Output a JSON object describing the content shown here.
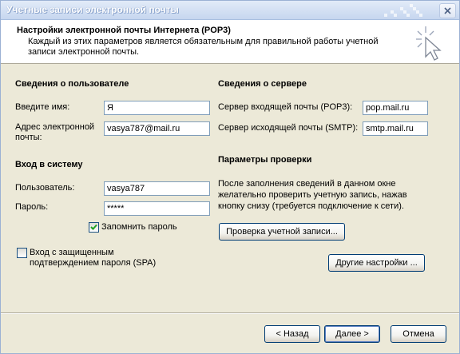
{
  "window": {
    "title": "Учетные записи электронной почты"
  },
  "header": {
    "title": "Настройки электронной почты Интернета (POP3)",
    "description": "Каждый из этих параметров является обязательным для правильной работы учетной записи электронной почты."
  },
  "user_info": {
    "heading": "Сведения о пользователе",
    "name_label": "Введите имя:",
    "name_value": "Я",
    "email_label_line1": "Адрес электронной",
    "email_label_line2": "почты:",
    "email_value": "vasya787@mail.ru"
  },
  "login": {
    "heading": "Вход в систему",
    "user_label": "Пользователь:",
    "user_value": "vasya787",
    "password_label": "Пароль:",
    "password_value": "*****",
    "remember_label": "Запомнить пароль",
    "remember_checked": true,
    "spa_label_line1": "Вход с защищенным",
    "spa_label_line2": "подтверждением пароля (SPA)",
    "spa_checked": false
  },
  "server_info": {
    "heading": "Сведения о сервере",
    "incoming_label": "Сервер входящей почты (POP3):",
    "incoming_value": "pop.mail.ru",
    "outgoing_label": "Сервер исходящей почты (SMTP):",
    "outgoing_value": "smtp.mail.ru"
  },
  "test": {
    "heading": "Параметры проверки",
    "description": "После заполнения сведений в данном окне желательно проверить учетную запись, нажав кнопку снизу (требуется подключение к сети).",
    "test_button": "Проверка учетной записи...",
    "more_button": "Другие настройки ..."
  },
  "footer": {
    "back_button": "< Назад",
    "next_button": "Далее >",
    "cancel_button": "Отмена"
  },
  "colors": {
    "title_bar": "#c6d6ef",
    "dialog_bg": "#ece9d8",
    "input_border": "#7f9db9",
    "button_border": "#003c74"
  },
  "icons": {
    "close": "close-icon",
    "wizard": "wizard-cursor-icon",
    "check": "checkmark-icon"
  }
}
